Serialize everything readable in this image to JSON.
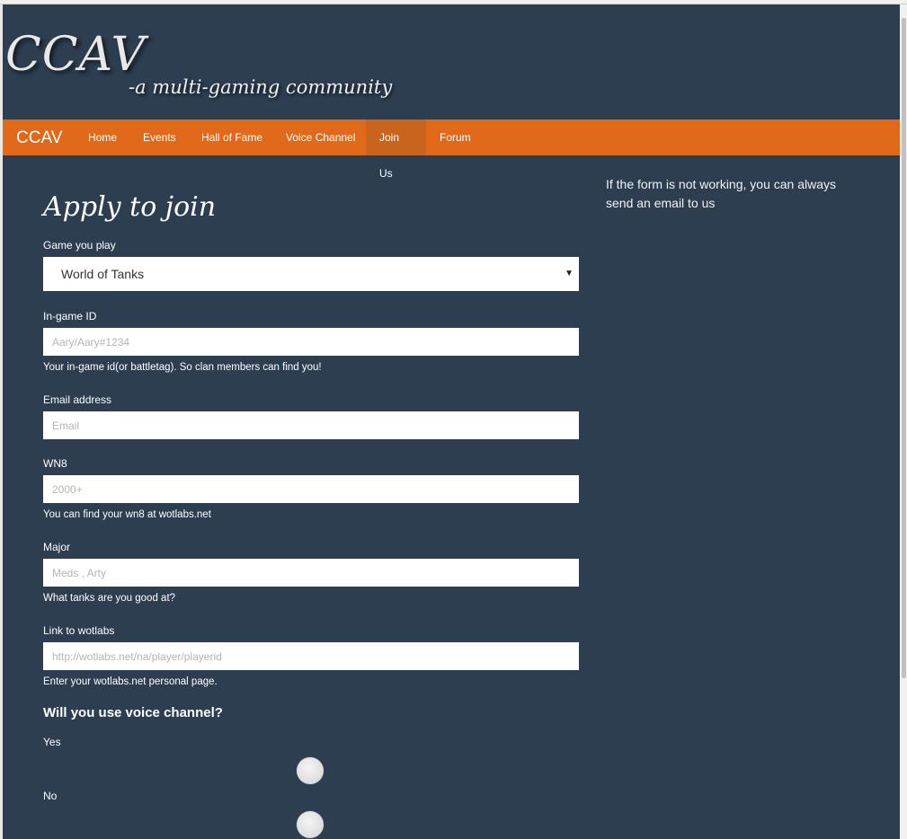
{
  "header": {
    "logo_title": "CCAV",
    "logo_subtitle": "-a multi-gaming community"
  },
  "navbar": {
    "brand": "CCAV",
    "items": [
      {
        "label": "Home",
        "active": false
      },
      {
        "label": "Events",
        "active": false
      },
      {
        "label": "Hall of Fame",
        "active": false
      },
      {
        "label": "Voice Channel",
        "active": false
      },
      {
        "label": "Join Us",
        "active": true
      },
      {
        "label": "Forum",
        "active": false
      }
    ]
  },
  "form": {
    "heading": "Apply to join",
    "game": {
      "label": "Game you play",
      "selected": "World of Tanks",
      "caret_icon": "caret-down-icon"
    },
    "ingame_id": {
      "label": "In-game ID",
      "placeholder": "Aary/Aary#1234",
      "help": "Your in-game id(or battletag). So clan members can find you!"
    },
    "email": {
      "label": "Email address",
      "placeholder": "Email"
    },
    "wn8": {
      "label": "WN8",
      "placeholder": "2000+",
      "help": "You can find your wn8 at wotlabs.net"
    },
    "major": {
      "label": "Major",
      "placeholder": "Meds , Arty",
      "help": "What tanks are you good at?"
    },
    "wotlabs": {
      "label": "Link to wotlabs",
      "placeholder": "http://wotlabs.net/na/player/playerid",
      "help": "Enter your wotlabs.net personal page."
    },
    "voice": {
      "question": "Will you use voice channel?",
      "yes_label": "Yes",
      "no_label": "No"
    }
  },
  "sidebar": {
    "note": "If the form is not working, you can always send an email to us"
  },
  "colors": {
    "background": "#2c3e50",
    "navbar": "#e0691a",
    "navbar_active": "#c9641e"
  }
}
